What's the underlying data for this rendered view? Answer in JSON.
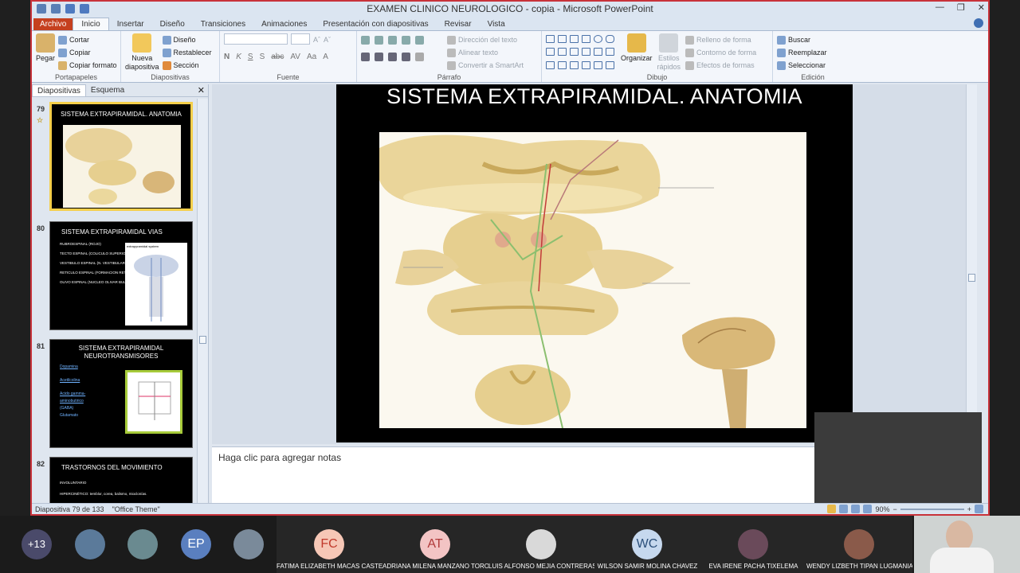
{
  "window": {
    "title": "EXAMEN CLINICO NEUROLOGICO - copia  -  Microsoft PowerPoint"
  },
  "tabs": [
    "Archivo",
    "Inicio",
    "Insertar",
    "Diseño",
    "Transiciones",
    "Animaciones",
    "Presentación con diapositivas",
    "Revisar",
    "Vista"
  ],
  "ribbon": {
    "portapapeles": {
      "pegar": "Pegar",
      "cortar": "Cortar",
      "copiar": "Copiar",
      "copiar_formato": "Copiar formato",
      "label": "Portapapeles"
    },
    "diapositivas": {
      "nueva": "Nueva",
      "nueva2": "diapositiva",
      "diseno": "Diseño",
      "restablecer": "Restablecer",
      "seccion": "Sección",
      "label": "Diapositivas"
    },
    "fuente": {
      "label": "Fuente",
      "bold": "N",
      "italic": "K",
      "underline": "S",
      "strike": "S",
      "abc": "abc",
      "av": "AV",
      "aa": "Aa",
      "a": "A"
    },
    "parrafo": {
      "direccion": "Dirección del texto",
      "alinear": "Alinear texto",
      "smartart": "Convertir a SmartArt",
      "label": "Párrafo"
    },
    "dibujo": {
      "organizar": "Organizar",
      "estilos": "Estilos",
      "estilos2": "rápidos",
      "relleno": "Relleno de forma",
      "contorno": "Contorno de forma",
      "efectos": "Efectos de formas",
      "label": "Dibujo"
    },
    "edicion": {
      "buscar": "Buscar",
      "reemplazar": "Reemplazar",
      "seleccionar": "Seleccionar",
      "label": "Edición"
    }
  },
  "panel": {
    "tab1": "Diapositivas",
    "tab2": "Esquema"
  },
  "thumbnails": [
    {
      "num": "79",
      "title": "SISTEMA EXTRAPIRAMIDAL. ANATOMIA"
    },
    {
      "num": "80",
      "title": "SISTEMA EXTRAPIRAMIDAL VIAS",
      "image_caption": "extrapyramidal system",
      "items": [
        "RUBROESPINAL (ROJO)",
        "TECTO ESPINAL (COLICULO SUPERIOR)",
        "VESTIBULO ESPINAL (N. VESTIBULARES BULBO)",
        "RETICULO ESPINAL (FORMACION RETICULAR)",
        "OLIVO ESPINAL (NUCLEO OLIVAR BULBAR)"
      ]
    },
    {
      "num": "81",
      "title": "SISTEMA  EXTRAPIRAMIDAL NEUROTRANSMISORES",
      "items": [
        "Dopamina",
        "Acetilcolina",
        "Acido gamma-aminobutirico",
        "(GABA)",
        "Glutamato"
      ]
    },
    {
      "num": "82",
      "title": "TRASTORNOS DEL MOVIMIENTO",
      "items": [
        "INVOLUNTARIO",
        "HIPERCINÉTICO: temblor, corea, balismo, mioclonías."
      ]
    }
  ],
  "slide": {
    "title": "SISTEMA EXTRAPIRAMIDAL. ANATOMIA"
  },
  "notes": {
    "placeholder": "Haga clic para agregar notas"
  },
  "status": {
    "slide": "Diapositiva 79 de 133",
    "theme": "\"Office Theme\"",
    "zoom": "90%"
  },
  "meeting": {
    "more": "+13",
    "initials": [
      "EP"
    ],
    "participants": [
      {
        "initials": "FC",
        "name": "FATIMA ELIZABETH MACAS CASTEL...",
        "color": "#f6c7b6",
        "text": "#c0392b"
      },
      {
        "initials": "AT",
        "name": "ADRIANA MILENA MANZANO TORO",
        "color": "#f3c4c4",
        "text": "#b03a3a"
      },
      {
        "initials": "",
        "name": "LUIS ALFONSO MEJIA CONTRERAS",
        "color": "#d9d9d9",
        "text": "#333"
      },
      {
        "initials": "WC",
        "name": "WILSON SAMIR MOLINA CHAVEZ",
        "color": "#c6d8ee",
        "text": "#2b4f7a"
      },
      {
        "initials": "",
        "name": "EVA IRENE PACHA TIXELEMA",
        "color": "#6a4a5a",
        "text": "#fff"
      },
      {
        "initials": "",
        "name": "WENDY LIZBETH TIPAN LUGMANIA",
        "color": "#8a5a4a",
        "text": "#fff"
      }
    ]
  }
}
